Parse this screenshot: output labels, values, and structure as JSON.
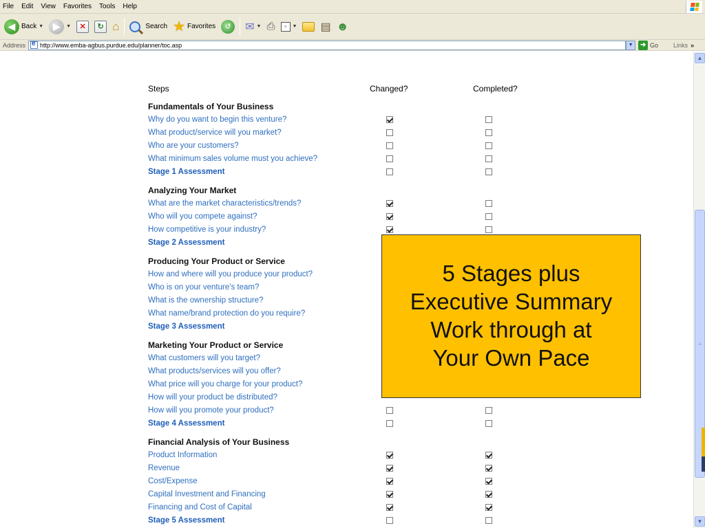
{
  "browser": {
    "menu": [
      "File",
      "Edit",
      "View",
      "Favorites",
      "Tools",
      "Help"
    ],
    "toolbar": {
      "back_label": "Back",
      "search_label": "Search",
      "favorites_label": "Favorites"
    },
    "address": {
      "label": "Address",
      "url": "http://www.emba-agbus.purdue.edu/planner/toc.asp",
      "go_label": "Go",
      "links_label": "Links"
    }
  },
  "planner": {
    "headers": {
      "steps": "Steps",
      "changed": "Changed?",
      "completed": "Completed?"
    },
    "sections": [
      {
        "title": "Fundamentals of Your Business",
        "rows": [
          {
            "label": "Why do you want to begin this venture?",
            "changed": true,
            "completed": false,
            "assessment": false
          },
          {
            "label": "What product/service will you market?",
            "changed": false,
            "completed": false,
            "assessment": false
          },
          {
            "label": "Who are your customers?",
            "changed": false,
            "completed": false,
            "assessment": false
          },
          {
            "label": "What minimum sales volume must you achieve?",
            "changed": false,
            "completed": false,
            "assessment": false
          },
          {
            "label": "Stage 1 Assessment",
            "changed": false,
            "completed": false,
            "assessment": true
          }
        ]
      },
      {
        "title": "Analyzing Your Market",
        "rows": [
          {
            "label": "What are the market characteristics/trends?",
            "changed": true,
            "completed": false,
            "assessment": false
          },
          {
            "label": "Who will you compete against?",
            "changed": true,
            "completed": false,
            "assessment": false
          },
          {
            "label": "How competitive is your industry?",
            "changed": true,
            "completed": false,
            "assessment": false
          },
          {
            "label": "Stage 2 Assessment",
            "changed": null,
            "completed": null,
            "assessment": true
          }
        ]
      },
      {
        "title": "Producing Your Product or Service",
        "rows": [
          {
            "label": "How and where will you produce your product?",
            "changed": null,
            "completed": null,
            "assessment": false
          },
          {
            "label": "Who is on your venture's team?",
            "changed": null,
            "completed": null,
            "assessment": false
          },
          {
            "label": "What is the ownership structure?",
            "changed": null,
            "completed": null,
            "assessment": false
          },
          {
            "label": "What name/brand protection do you require?",
            "changed": null,
            "completed": null,
            "assessment": false
          },
          {
            "label": "Stage 3 Assessment",
            "changed": null,
            "completed": null,
            "assessment": true
          }
        ]
      },
      {
        "title": "Marketing Your Product or Service",
        "rows": [
          {
            "label": "What customers will you target?",
            "changed": null,
            "completed": null,
            "assessment": false
          },
          {
            "label": "What products/services will you offer?",
            "changed": null,
            "completed": null,
            "assessment": false
          },
          {
            "label": "What price will you charge for your product?",
            "changed": null,
            "completed": null,
            "assessment": false
          },
          {
            "label": "How will your product be distributed?",
            "changed": null,
            "completed": null,
            "assessment": false
          },
          {
            "label": "How will you promote your product?",
            "changed": false,
            "completed": false,
            "assessment": false
          },
          {
            "label": "Stage 4 Assessment",
            "changed": false,
            "completed": false,
            "assessment": true
          }
        ]
      },
      {
        "title": "Financial Analysis of Your Business",
        "rows": [
          {
            "label": "Product Information",
            "changed": true,
            "completed": true,
            "assessment": false
          },
          {
            "label": "Revenue",
            "changed": true,
            "completed": true,
            "assessment": false
          },
          {
            "label": "Cost/Expense",
            "changed": true,
            "completed": true,
            "assessment": false
          },
          {
            "label": "Capital Investment and Financing",
            "changed": true,
            "completed": true,
            "assessment": false
          },
          {
            "label": "Financing and Cost of Capital",
            "changed": true,
            "completed": true,
            "assessment": false
          },
          {
            "label": "Stage 5 Assessment",
            "changed": false,
            "completed": false,
            "assessment": true
          }
        ]
      }
    ]
  },
  "callout": {
    "lines": [
      "5 Stages plus",
      "Executive Summary",
      "Work through at",
      "Your Own Pace"
    ]
  },
  "colors": {
    "link": "#2f6fbf",
    "callout_bg": "#ffc000",
    "chrome_bg": "#ece9d8"
  }
}
